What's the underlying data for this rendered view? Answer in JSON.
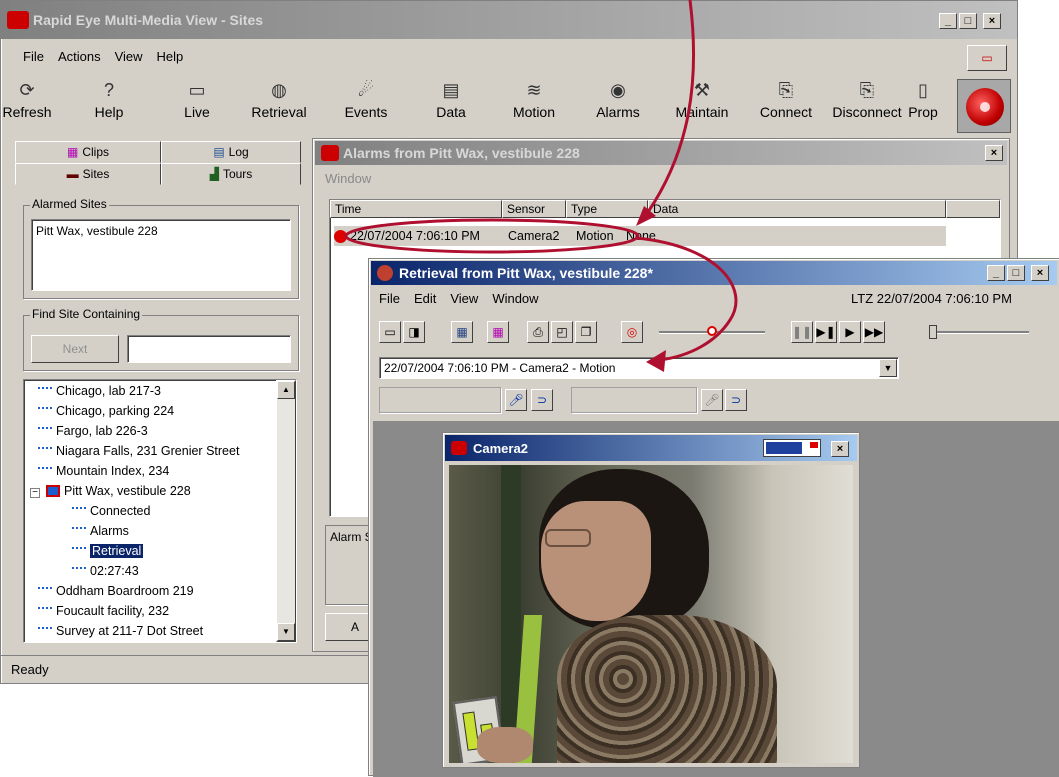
{
  "main_window": {
    "title": "Rapid Eye Multi-Media View - Sites",
    "menu": [
      "File",
      "Actions",
      "View",
      "Help"
    ],
    "toolbar": [
      {
        "label": "Refresh",
        "icon": "refresh-icon",
        "glyph": "⟳"
      },
      {
        "label": "Help",
        "icon": "help-icon",
        "glyph": "?"
      },
      {
        "label": "Live",
        "icon": "camera-icon",
        "glyph": "▭"
      },
      {
        "label": "Retrieval",
        "icon": "retrieval-icon",
        "glyph": "◍"
      },
      {
        "label": "Events",
        "icon": "events-icon",
        "glyph": "☄"
      },
      {
        "label": "Data",
        "icon": "data-icon",
        "glyph": "▤"
      },
      {
        "label": "Motion",
        "icon": "motion-icon",
        "glyph": "≋"
      },
      {
        "label": "Alarms",
        "icon": "alarms-icon",
        "glyph": "◉"
      },
      {
        "label": "Maintain",
        "icon": "maintain-icon",
        "glyph": "⚒"
      },
      {
        "label": "Connect",
        "icon": "connect-icon",
        "glyph": "⎘"
      },
      {
        "label": "Disconnect",
        "icon": "disconnect-icon",
        "glyph": "⎘"
      },
      {
        "label": "Prop",
        "icon": "properties-icon",
        "glyph": "▯"
      }
    ],
    "tabs": {
      "clips": "Clips",
      "log": "Log",
      "sites": "Sites",
      "tours": "Tours"
    },
    "alarmed_sites": {
      "label": "Alarmed Sites",
      "items": [
        "Pitt Wax, vestibule 228"
      ]
    },
    "find_site": {
      "label": "Find Site Containing",
      "next": "Next",
      "value": ""
    },
    "tree": [
      {
        "label": "Chicago, lab 217-3",
        "level": 0
      },
      {
        "label": "Chicago, parking 224",
        "level": 0
      },
      {
        "label": "Fargo, lab 226-3",
        "level": 0
      },
      {
        "label": "Niagara Falls, 231 Grenier Street",
        "level": 0
      },
      {
        "label": "Mountain Index, 234",
        "level": 0
      },
      {
        "label": "Pitt Wax, vestibule 228",
        "level": 0,
        "expanded": true
      },
      {
        "label": "Connected",
        "level": 1
      },
      {
        "label": "Alarms",
        "level": 1
      },
      {
        "label": "Retrieval",
        "level": 1,
        "selected": true
      },
      {
        "label": "02:27:43",
        "level": 1
      },
      {
        "label": "Oddham Boardroom 219",
        "level": 0
      },
      {
        "label": "Foucault facility, 232",
        "level": 0
      },
      {
        "label": "Survey at 211-7 Dot Street",
        "level": 0
      }
    ],
    "status": "Ready"
  },
  "alarms_window": {
    "title": "Alarms from Pitt Wax, vestibule 228",
    "menu": "Window",
    "columns": [
      "Time",
      "Sensor",
      "Type",
      "Data"
    ],
    "row": {
      "time": "22/07/2004 7:06:10 PM",
      "sensor": "Camera2",
      "type": "Motion",
      "data": "None"
    },
    "alarm_label": "Alarm S",
    "button": "A"
  },
  "retrieval_window": {
    "title": "Retrieval from Pitt Wax, vestibule 228*",
    "menu": [
      "File",
      "Edit",
      "View",
      "Window"
    ],
    "ltz": "LTZ 22/07/2004 7:06:10 PM",
    "dropdown": "22/07/2004 7:06:10 PM - Camera2 - Motion"
  },
  "camera_window": {
    "title": "Camera2"
  },
  "colors": {
    "annotation": "#b01030",
    "alarm_dot": "#dd0000",
    "title_active": "#0a246a"
  }
}
